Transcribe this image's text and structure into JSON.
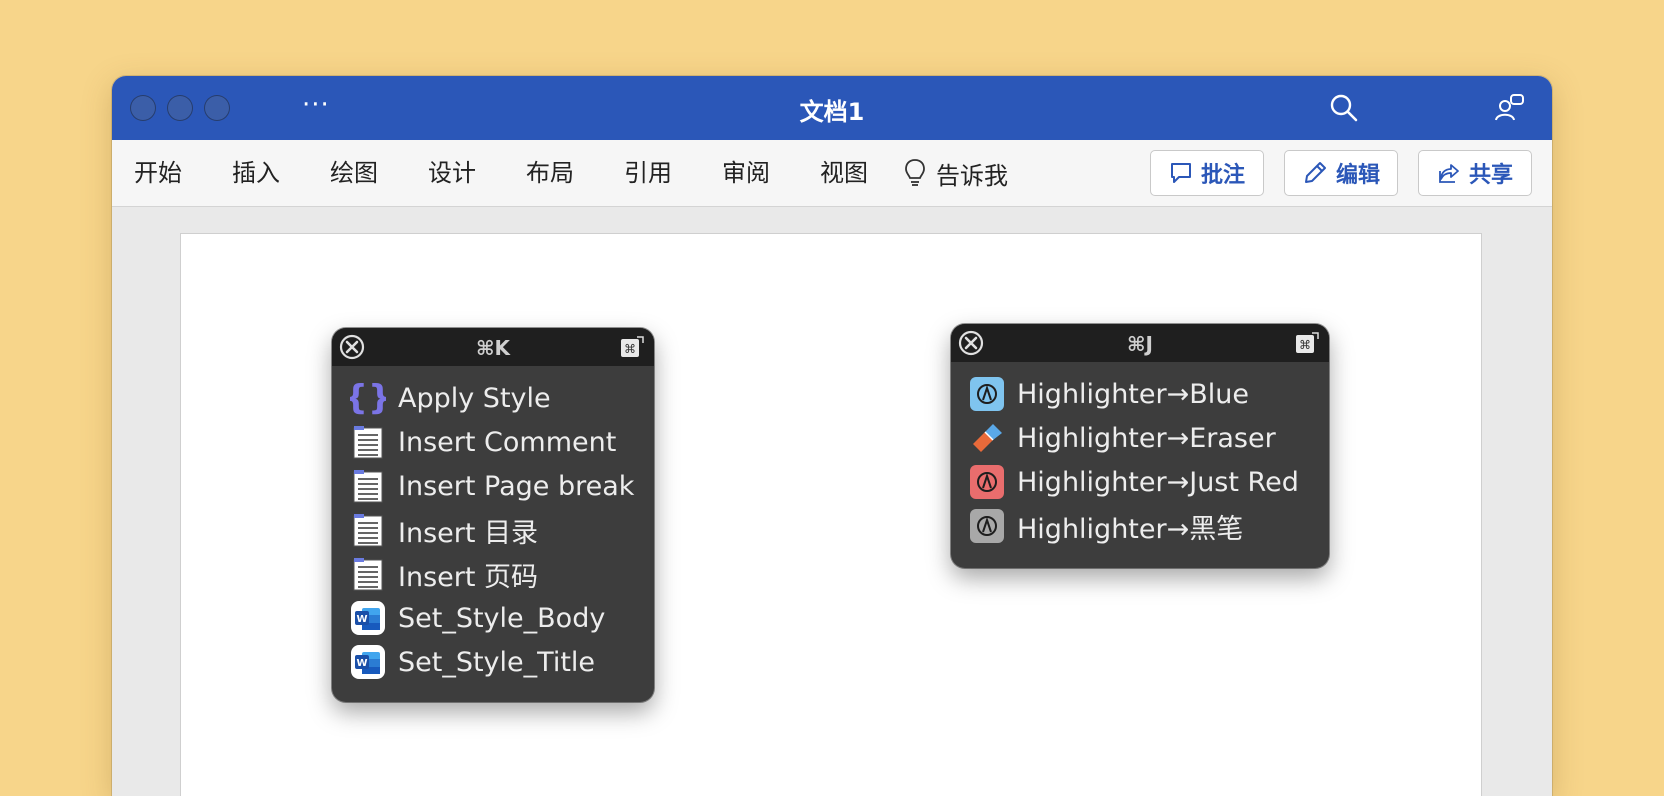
{
  "window": {
    "title": "文档1",
    "more_label": "···",
    "titlebar_color": "#2b57b8"
  },
  "ribbon": {
    "tabs": [
      "开始",
      "插入",
      "绘图",
      "设计",
      "布局",
      "引用",
      "审阅",
      "视图"
    ],
    "tell_me": "告诉我",
    "comments_label": "批注",
    "edit_label": "编辑",
    "share_label": "共享"
  },
  "palette_k": {
    "title": "⌘K",
    "items": [
      {
        "label": "Apply Style",
        "icon": "braces-icon"
      },
      {
        "label": "Insert Comment",
        "icon": "document-list-icon"
      },
      {
        "label": "Insert Page break",
        "icon": "document-list-icon"
      },
      {
        "label": "Insert 目录",
        "icon": "document-list-icon"
      },
      {
        "label": "Insert 页码",
        "icon": "document-list-icon"
      },
      {
        "label": "Set_Style_Body",
        "icon": "word-app-icon"
      },
      {
        "label": "Set_Style_Title",
        "icon": "word-app-icon"
      }
    ]
  },
  "palette_j": {
    "title": "⌘J",
    "items": [
      {
        "label": "Highlighter→Blue",
        "icon": "highlighter-blue-icon",
        "color": "#7fc4ef"
      },
      {
        "label": "Highlighter→Eraser",
        "icon": "eraser-icon",
        "color": "#e86a3a"
      },
      {
        "label": "Highlighter→Just Red",
        "icon": "highlighter-red-icon",
        "color": "#e96d6d"
      },
      {
        "label": "Highlighter→黑笔",
        "icon": "highlighter-black-icon",
        "color": "#a8a8a8"
      }
    ]
  }
}
